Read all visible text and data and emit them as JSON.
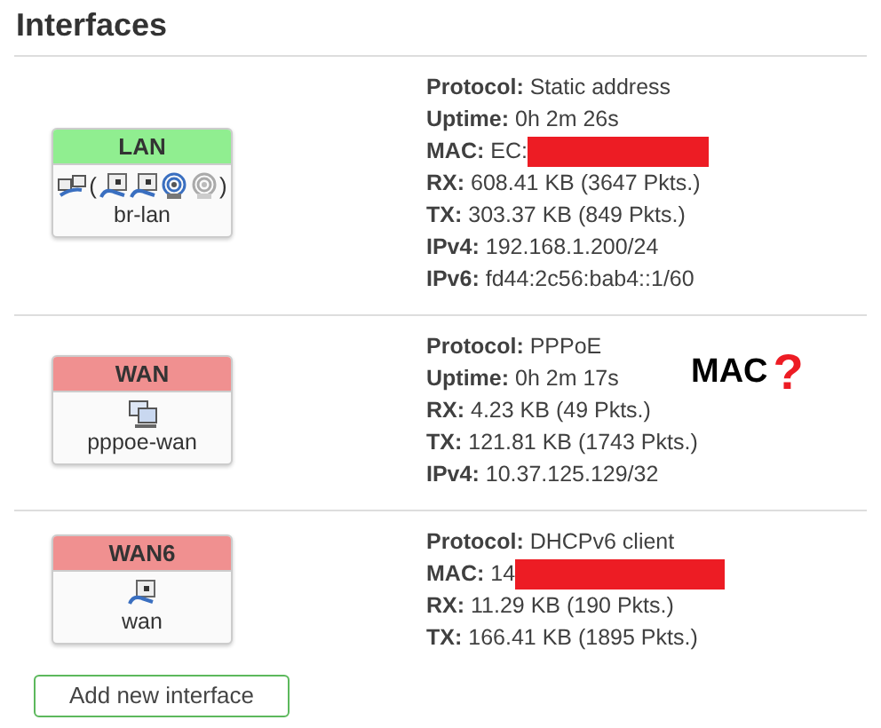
{
  "heading": "Interfaces",
  "interfaces": [
    {
      "name": "LAN",
      "color": "#90ee90",
      "device": "br-lan",
      "device_icons": [
        {
          "kind": "bridge"
        },
        {
          "kind": "text",
          "text": "("
        },
        {
          "kind": "port"
        },
        {
          "kind": "port"
        },
        {
          "kind": "wifi",
          "enabled": true
        },
        {
          "kind": "wifi",
          "enabled": false
        },
        {
          "kind": "text",
          "text": ")"
        }
      ],
      "details": [
        {
          "label": "Protocol:",
          "value": "Static address",
          "redacted": false
        },
        {
          "label": "Uptime:",
          "value": "0h 2m 26s",
          "redacted": false
        },
        {
          "label": "MAC:",
          "value": "EC:",
          "redacted": true
        },
        {
          "label": "RX:",
          "value": "608.41 KB (3647 Pkts.)",
          "redacted": false
        },
        {
          "label": "TX:",
          "value": "303.37 KB (849 Pkts.)",
          "redacted": false
        },
        {
          "label": "IPv4:",
          "value": "192.168.1.200/24",
          "redacted": false
        },
        {
          "label": "IPv6:",
          "value": "fd44:2c56:bab4::1/60",
          "redacted": false
        }
      ]
    },
    {
      "name": "WAN",
      "color": "#f09090",
      "device": "pppoe-wan",
      "device_icons": [
        {
          "kind": "tunnel"
        }
      ],
      "details": [
        {
          "label": "Protocol:",
          "value": "PPPoE",
          "redacted": false
        },
        {
          "label": "Uptime:",
          "value": "0h 2m 17s",
          "redacted": false
        },
        {
          "label": "RX:",
          "value": "4.23 KB (49 Pkts.)",
          "redacted": false
        },
        {
          "label": "TX:",
          "value": "121.81 KB (1743 Pkts.)",
          "redacted": false
        },
        {
          "label": "IPv4:",
          "value": "10.37.125.129/32",
          "redacted": false
        }
      ],
      "note": {
        "text": "MAC",
        "mark": "?"
      }
    },
    {
      "name": "WAN6",
      "color": "#f09090",
      "device": "wan",
      "device_icons": [
        {
          "kind": "port"
        }
      ],
      "details": [
        {
          "label": "Protocol:",
          "value": "DHCPv6 client",
          "redacted": false
        },
        {
          "label": "MAC:",
          "value": "14",
          "redacted": true
        },
        {
          "label": "RX:",
          "value": "11.29 KB (190 Pkts.)",
          "redacted": false
        },
        {
          "label": "TX:",
          "value": "166.41 KB (1895 Pkts.)",
          "redacted": false
        }
      ]
    }
  ],
  "add_button": "Add new interface"
}
